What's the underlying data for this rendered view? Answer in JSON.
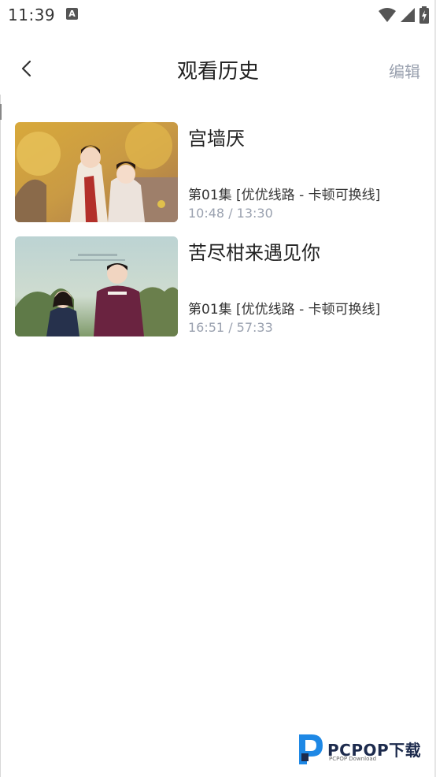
{
  "status_bar": {
    "time": "11:39",
    "notification_icon": "A"
  },
  "header": {
    "title": "观看历史",
    "edit_label": "编辑"
  },
  "history": [
    {
      "title": "宫墙厌",
      "episode": "第01集 [优优线路 - 卡顿可换线]",
      "progress": "10:48 / 13:30"
    },
    {
      "title": "苦尽柑来遇见你",
      "episode": "第01集 [优优线路 - 卡顿可换线]",
      "progress": "16:51 / 57:33"
    }
  ],
  "watermark": {
    "brand": "PCPOP下载",
    "sub": "PCPOP Download"
  },
  "colors": {
    "edit": "#9aa1af",
    "progress": "#9aa1af",
    "watermark_blue": "#1e88e5",
    "watermark_navy": "#1d2b4d"
  }
}
